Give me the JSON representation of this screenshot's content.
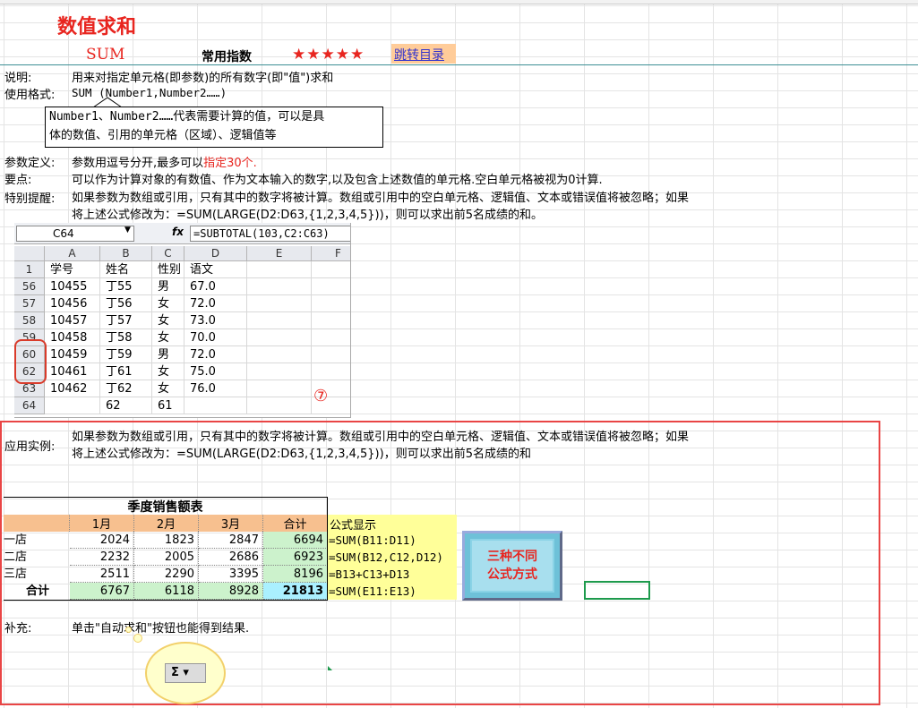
{
  "header": {
    "title": "数值求和",
    "func_name": "SUM",
    "freq_label": "常用指数",
    "stars": "★★★★★",
    "jump_link": "跳转目录"
  },
  "desc": {
    "label": "说明:",
    "text": "用来对指定单元格(即参数)的所有数字(即\"值\")求和"
  },
  "usage": {
    "label": "使用格式:",
    "text": "SUM (Number1,Number2……)"
  },
  "callout": {
    "line1": "Number1、Number2……代表需要计算的值，可以是具",
    "line2": "体的数值、引用的单元格（区域）、逻辑值等"
  },
  "param": {
    "label": "参数定义:",
    "text": "参数用逗号分开,最多可以",
    "highlight": "指定30个."
  },
  "keypoint": {
    "label": "要点:",
    "text": "可以作为计算对象的有数值、作为文本输入的数字,以及包含上述数值的单元格.空白单元格被视为0计算."
  },
  "note": {
    "label": "特别提醒:",
    "line1": "如果参数为数组或引用，只有其中的数字将被计算。数组或引用中的空白单元格、逻辑值、文本或错误值将被忽略；如果",
    "line2": "将上述公式修改为：=SUM(LARGE(D2:D63,{1,2,3,4,5}))，则可以求出前5名成绩的和。"
  },
  "mini_excel": {
    "name_box": "C64",
    "fx": "fx",
    "formula": "=SUBTOTAL(103,C2:C63)",
    "columns": [
      "A",
      "B",
      "C",
      "D",
      "E",
      "F"
    ],
    "header_row": {
      "row": "1",
      "cells": [
        "学号",
        "姓名",
        "性别",
        "语文",
        "",
        ""
      ]
    },
    "rows": [
      {
        "row": "56",
        "cells": [
          "10455",
          "丁55",
          "男",
          "67.0"
        ]
      },
      {
        "row": "57",
        "cells": [
          "10456",
          "丁56",
          "女",
          "72.0"
        ]
      },
      {
        "row": "58",
        "cells": [
          "10457",
          "丁57",
          "女",
          "73.0"
        ]
      },
      {
        "row": "59",
        "cells": [
          "10458",
          "丁58",
          "女",
          "70.0"
        ]
      },
      {
        "row": "60",
        "cells": [
          "10459",
          "丁59",
          "男",
          "72.0"
        ]
      },
      {
        "row": "62",
        "cells": [
          "10461",
          "丁61",
          "女",
          "75.0"
        ]
      },
      {
        "row": "63",
        "cells": [
          "10462",
          "丁62",
          "女",
          "76.0"
        ]
      },
      {
        "row": "64",
        "cells": [
          "",
          "62",
          "61",
          ""
        ]
      }
    ],
    "marker": "⑦"
  },
  "example": {
    "label": "应用实例:",
    "line1": "如果参数为数组或引用，只有其中的数字将被计算。数组或引用中的空白单元格、逻辑值、文本或错误值将被忽略；如果",
    "line2": "将上述公式修改为：=SUM(LARGE(D2:D63,{1,2,3,4,5}))，则可以求出前5名成绩的和"
  },
  "sales": {
    "title": "季度销售额表",
    "headers": [
      "1月",
      "2月",
      "3月",
      "合计"
    ],
    "formula_header": "公式显示",
    "rows": [
      {
        "name": "一店",
        "v": [
          "2024",
          "1823",
          "2847",
          "6694"
        ],
        "formula": "=SUM(B11:D11)"
      },
      {
        "name": "二店",
        "v": [
          "2232",
          "2005",
          "2686",
          "6923"
        ],
        "formula": "=SUM(B12,C12,D12)"
      },
      {
        "name": "三店",
        "v": [
          "2511",
          "2290",
          "3395",
          "8196"
        ],
        "formula": "=B13+C13+D13"
      },
      {
        "name": "合计",
        "v": [
          "6767",
          "6118",
          "8928",
          "21813"
        ],
        "formula": "=SUM(E11:E13)"
      }
    ]
  },
  "three_button": {
    "line1": "三种不同",
    "line2": "公式方式"
  },
  "supplement": {
    "label": "补充:",
    "text": "单击\"自动求和\"按钮也能得到结果."
  },
  "autosum": {
    "label": "Σ ▾"
  },
  "colors": {
    "red": "#e8251f",
    "orange_header": "#f7c08f",
    "green_total": "#ccf2cc",
    "yellow_formula": "#ffff99",
    "cyan_button": "#8ad3e6"
  }
}
